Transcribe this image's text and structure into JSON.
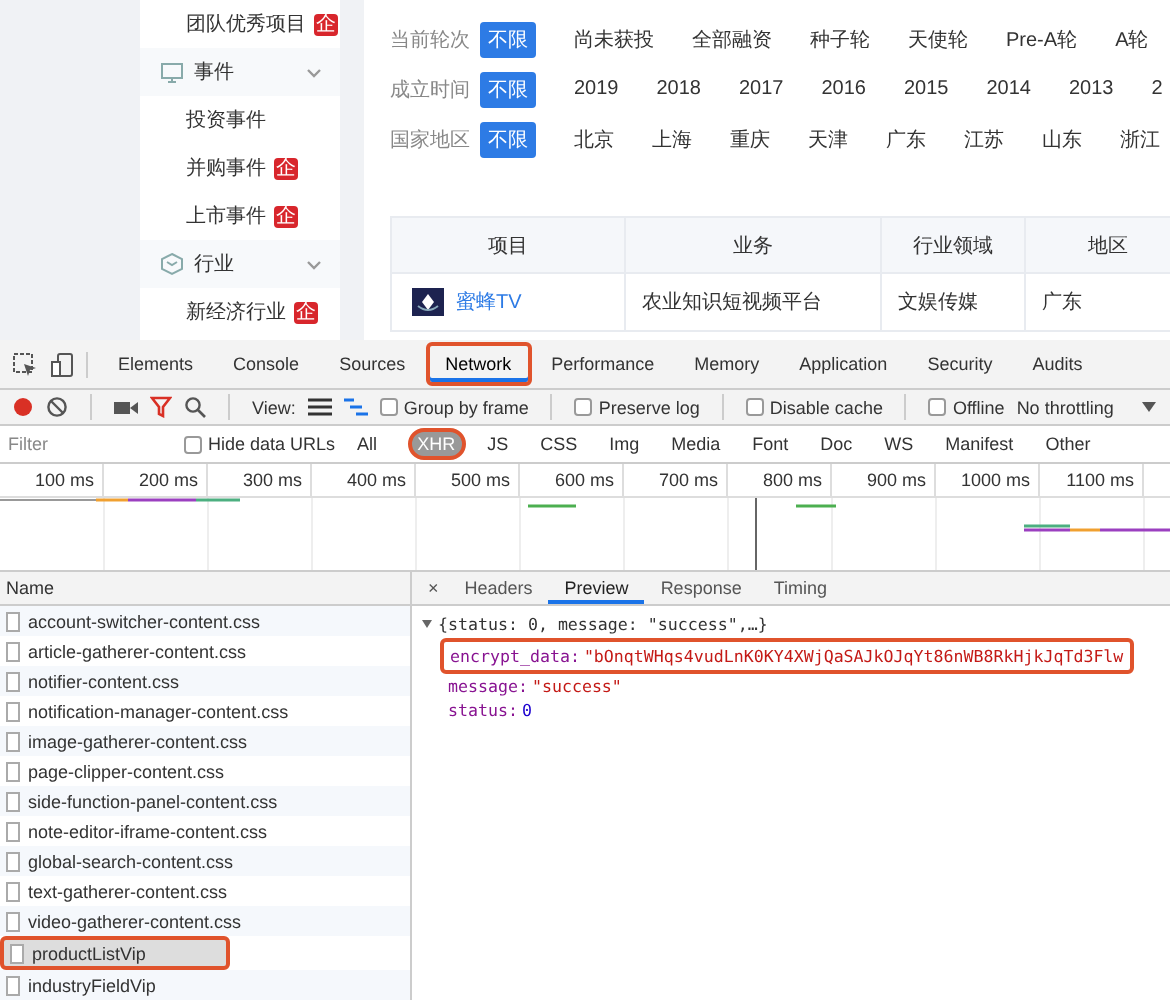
{
  "site": {
    "sidebar": [
      {
        "label": "团队优秀项目",
        "kind": "item",
        "badge": "企"
      },
      {
        "label": "事件",
        "kind": "section",
        "expanded": true
      },
      {
        "label": "投资事件",
        "kind": "item"
      },
      {
        "label": "并购事件",
        "kind": "item",
        "badge": "企"
      },
      {
        "label": "上市事件",
        "kind": "item",
        "badge": "企"
      },
      {
        "label": "行业",
        "kind": "section",
        "expanded": true
      },
      {
        "label": "新经济行业",
        "kind": "item",
        "badge": "企"
      }
    ],
    "filters": [
      {
        "label": "当前轮次",
        "options": [
          {
            "label": "不限",
            "selected": true
          },
          {
            "label": "尚未获投",
            "selected": false
          },
          {
            "label": "全部融资",
            "selected": false
          },
          {
            "label": "种子轮",
            "selected": false
          },
          {
            "label": "天使轮",
            "selected": false
          },
          {
            "label": "Pre-A轮",
            "selected": false
          },
          {
            "label": "A轮",
            "selected": false
          }
        ]
      },
      {
        "label": "成立时间",
        "options": [
          {
            "label": "不限",
            "selected": true
          },
          {
            "label": "2019",
            "selected": false
          },
          {
            "label": "2018",
            "selected": false
          },
          {
            "label": "2017",
            "selected": false
          },
          {
            "label": "2016",
            "selected": false
          },
          {
            "label": "2015",
            "selected": false
          },
          {
            "label": "2014",
            "selected": false
          },
          {
            "label": "2013",
            "selected": false
          },
          {
            "label": "2",
            "selected": false
          }
        ]
      },
      {
        "label": "国家地区",
        "options": [
          {
            "label": "不限",
            "selected": true
          },
          {
            "label": "北京",
            "selected": false
          },
          {
            "label": "上海",
            "selected": false
          },
          {
            "label": "重庆",
            "selected": false
          },
          {
            "label": "天津",
            "selected": false
          },
          {
            "label": "广东",
            "selected": false
          },
          {
            "label": "江苏",
            "selected": false
          },
          {
            "label": "山东",
            "selected": false
          },
          {
            "label": "浙江",
            "selected": false
          }
        ]
      }
    ],
    "table": {
      "columns": [
        "项目",
        "业务",
        "行业领域",
        "地区"
      ],
      "rows": [
        {
          "cells": [
            "蜜蜂TV",
            "农业知识短视频平台",
            "文娱传媒",
            "广东"
          ]
        }
      ]
    }
  },
  "devtools": {
    "tabs": [
      {
        "label": "Elements",
        "selected": false,
        "highlighted": false
      },
      {
        "label": "Console",
        "selected": false,
        "highlighted": false
      },
      {
        "label": "Sources",
        "selected": false,
        "highlighted": false
      },
      {
        "label": "Network",
        "selected": true,
        "highlighted": true
      },
      {
        "label": "Performance",
        "selected": false,
        "highlighted": false
      },
      {
        "label": "Memory",
        "selected": false,
        "highlighted": false
      },
      {
        "label": "Application",
        "selected": false,
        "highlighted": false
      },
      {
        "label": "Security",
        "selected": false,
        "highlighted": false
      },
      {
        "label": "Audits",
        "selected": false,
        "highlighted": false
      }
    ],
    "toolbar": {
      "recording": true,
      "filter_active": true,
      "view_label": "View:",
      "checkboxes": [
        {
          "label": "Group by frame",
          "checked": false
        },
        {
          "label": "Preserve log",
          "checked": false
        },
        {
          "label": "Disable cache",
          "checked": false
        },
        {
          "label": "Offline",
          "checked": false
        }
      ],
      "throttling": "No throttling"
    },
    "filter": {
      "placeholder": "Filter",
      "hide_data_urls": {
        "label": "Hide data URLs",
        "checked": false
      },
      "types": [
        {
          "label": "All",
          "selected": false,
          "highlighted": false
        },
        {
          "label": "XHR",
          "selected": true,
          "highlighted": true
        },
        {
          "label": "JS",
          "selected": false,
          "highlighted": false
        },
        {
          "label": "CSS",
          "selected": false,
          "highlighted": false
        },
        {
          "label": "Img",
          "selected": false,
          "highlighted": false
        },
        {
          "label": "Media",
          "selected": false,
          "highlighted": false
        },
        {
          "label": "Font",
          "selected": false,
          "highlighted": false
        },
        {
          "label": "Doc",
          "selected": false,
          "highlighted": false
        },
        {
          "label": "WS",
          "selected": false,
          "highlighted": false
        },
        {
          "label": "Manifest",
          "selected": false,
          "highlighted": false
        },
        {
          "label": "Other",
          "selected": false,
          "highlighted": false
        }
      ]
    },
    "timeline": {
      "ticks": [
        "100 ms",
        "200 ms",
        "300 ms",
        "400 ms",
        "500 ms",
        "600 ms",
        "700 ms",
        "800 ms",
        "900 ms",
        "1000 ms",
        "1100 ms"
      ]
    },
    "requests": {
      "header": "Name",
      "rows": [
        {
          "name": "account-switcher-content.css",
          "selected": false,
          "highlighted": false
        },
        {
          "name": "article-gatherer-content.css",
          "selected": false,
          "highlighted": false
        },
        {
          "name": "notifier-content.css",
          "selected": false,
          "highlighted": false
        },
        {
          "name": "notification-manager-content.css",
          "selected": false,
          "highlighted": false
        },
        {
          "name": "image-gatherer-content.css",
          "selected": false,
          "highlighted": false
        },
        {
          "name": "page-clipper-content.css",
          "selected": false,
          "highlighted": false
        },
        {
          "name": "side-function-panel-content.css",
          "selected": false,
          "highlighted": false
        },
        {
          "name": "note-editor-iframe-content.css",
          "selected": false,
          "highlighted": false
        },
        {
          "name": "global-search-content.css",
          "selected": false,
          "highlighted": false
        },
        {
          "name": "text-gatherer-content.css",
          "selected": false,
          "highlighted": false
        },
        {
          "name": "video-gatherer-content.css",
          "selected": false,
          "highlighted": false
        },
        {
          "name": "productListVip",
          "selected": true,
          "highlighted": true
        },
        {
          "name": "industryFieldVip",
          "selected": false,
          "highlighted": false
        }
      ]
    },
    "detail": {
      "close": "×",
      "tabs": [
        {
          "label": "Headers",
          "selected": false
        },
        {
          "label": "Preview",
          "selected": true
        },
        {
          "label": "Response",
          "selected": false
        },
        {
          "label": "Timing",
          "selected": false
        }
      ],
      "preview": [
        {
          "kind": "summary",
          "text": "{status: 0, message: \"success\",…}",
          "expanded": true,
          "highlighted": false
        },
        {
          "kind": "string",
          "key": "encrypt_data:",
          "value": "\"bOnqtWHqs4vudLnK0KY4XWjQaSAJkOJqYt86nWB8RkHjkJqTd3Flw",
          "highlighted": true
        },
        {
          "kind": "string",
          "key": "message:",
          "value": "\"success\"",
          "highlighted": false
        },
        {
          "kind": "number",
          "key": "status:",
          "value": "0",
          "highlighted": false
        }
      ]
    }
  }
}
